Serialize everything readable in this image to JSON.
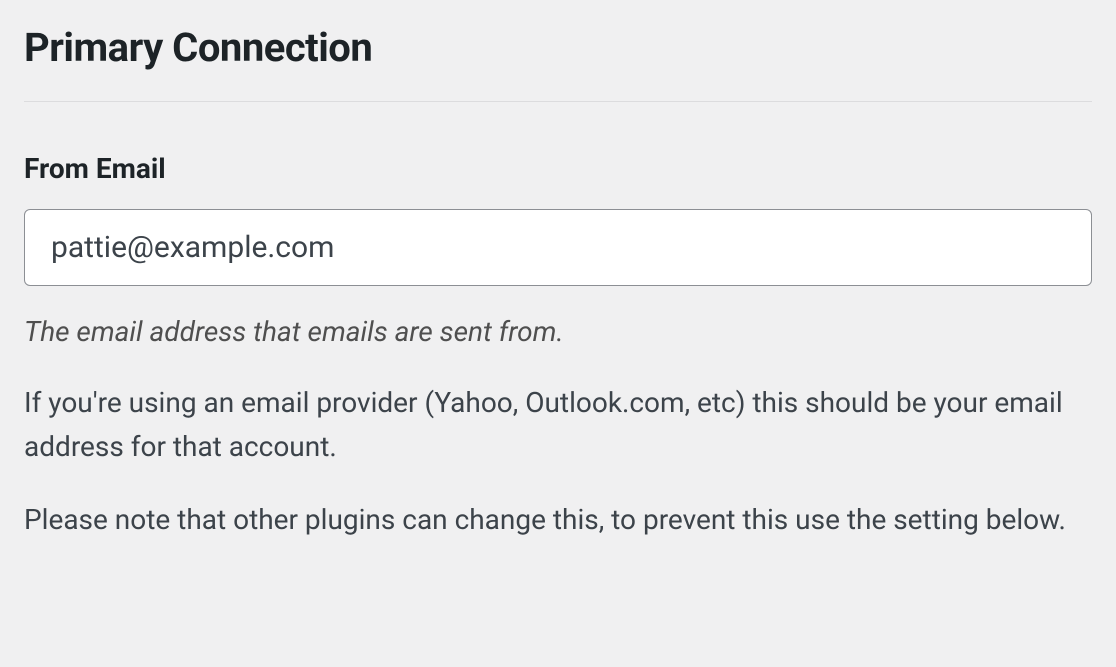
{
  "section": {
    "heading": "Primary Connection"
  },
  "fromEmail": {
    "label": "From Email",
    "value": "pattie@example.com",
    "helpItalic": "The email address that emails are sent from.",
    "help1": "If you're using an email provider (Yahoo, Outlook.com, etc) this should be your email address for that account.",
    "help2": "Please note that other plugins can change this, to prevent this use the setting below."
  }
}
